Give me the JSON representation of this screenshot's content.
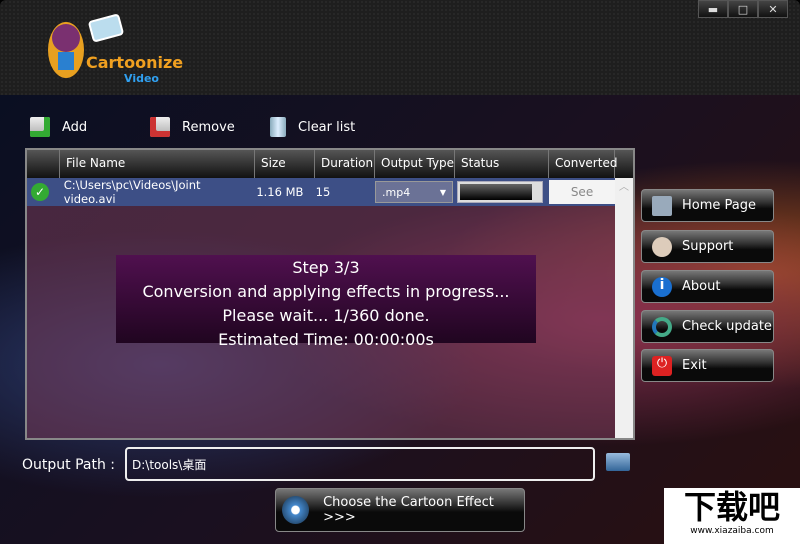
{
  "app": {
    "logo_text": "Cartoonize Video"
  },
  "window": {
    "minimize": "▬",
    "maximize": "□",
    "close": "✕"
  },
  "toolbar": {
    "add": "Add",
    "remove": "Remove",
    "clear": "Clear list"
  },
  "table": {
    "columns": [
      "",
      "File Name",
      "Size",
      "Duration",
      "Output Type",
      "Status",
      "Converted"
    ],
    "rows": [
      {
        "file": "C:\\Users\\pc\\Videos\\Joint video.avi",
        "size": "1.16 MB",
        "duration": "15",
        "output_type": ".mp4",
        "status_progress": 0.9,
        "converted": "See"
      }
    ]
  },
  "progress": {
    "line1": "Step 3/3",
    "line2": "Conversion and applying effects in progress...",
    "line3": "Please wait... 1/360 done.",
    "line4": "Estimated Time: 00:00:00s"
  },
  "side": [
    "Home Page",
    "Support",
    "About",
    "Check update",
    "Exit"
  ],
  "output": {
    "label": "Output Path :",
    "value": "D:\\tools\\桌面"
  },
  "choose": "Choose the Cartoon Effect >>>",
  "watermark": {
    "big": "下载吧",
    "small": "www.xiazaiba.com"
  }
}
